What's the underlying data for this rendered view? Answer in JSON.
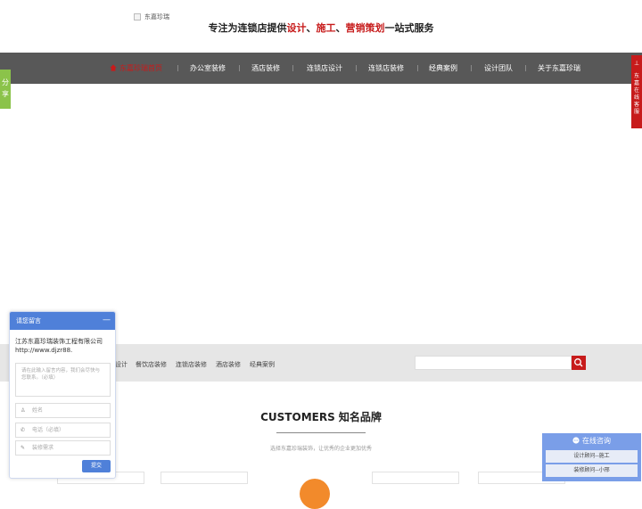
{
  "header": {
    "logo_alt": "东嘉珍瑞",
    "slogan_parts": [
      "专注为连锁店提供",
      "设计",
      "、",
      "施工",
      "、",
      "营销策划",
      "一站式服务"
    ]
  },
  "nav": {
    "items": [
      "东嘉珍瑞首页",
      "办公室装修",
      "酒店装修",
      "连锁店设计",
      "连锁店装修",
      "经典案例",
      "设计团队",
      "关于东嘉珍瑞"
    ]
  },
  "side": {
    "share": [
      "分",
      "享"
    ],
    "kefu": [
      "东",
      "嘉",
      "在",
      "线",
      "客",
      "服"
    ]
  },
  "catbar": {
    "items": [
      "设计",
      "餐饮店装修",
      "连锁店装修",
      "酒店装修",
      "经典案例"
    ],
    "search_placeholder": ""
  },
  "customers": {
    "title": "CUSTOMERS 知名品牌",
    "subtitle": "选择东嘉珍瑞装饰，让优秀的企业更加优秀"
  },
  "message_panel": {
    "title": "请您留言",
    "minimize": "—",
    "company": "江苏东嘉珍瑞装饰工程有限公司",
    "url": "http://www.djzr88.",
    "textarea_placeholder": "请在此输入留言内容，我们会尽快与您联系。（必填）",
    "name_placeholder": "姓名",
    "phone_placeholder": "电话（必填）",
    "need_placeholder": "装修需求",
    "submit": "提交"
  },
  "consult": {
    "title": "在线咨询",
    "buttons": [
      "设计顾问--施工",
      "装修顾问--小邢"
    ]
  },
  "colors": {
    "accent_red": "#c71b1b",
    "nav_bg": "#585858",
    "panel_blue": "#4f80d9",
    "consult_blue": "#7a9ee8",
    "share_green": "#8bc34a"
  }
}
